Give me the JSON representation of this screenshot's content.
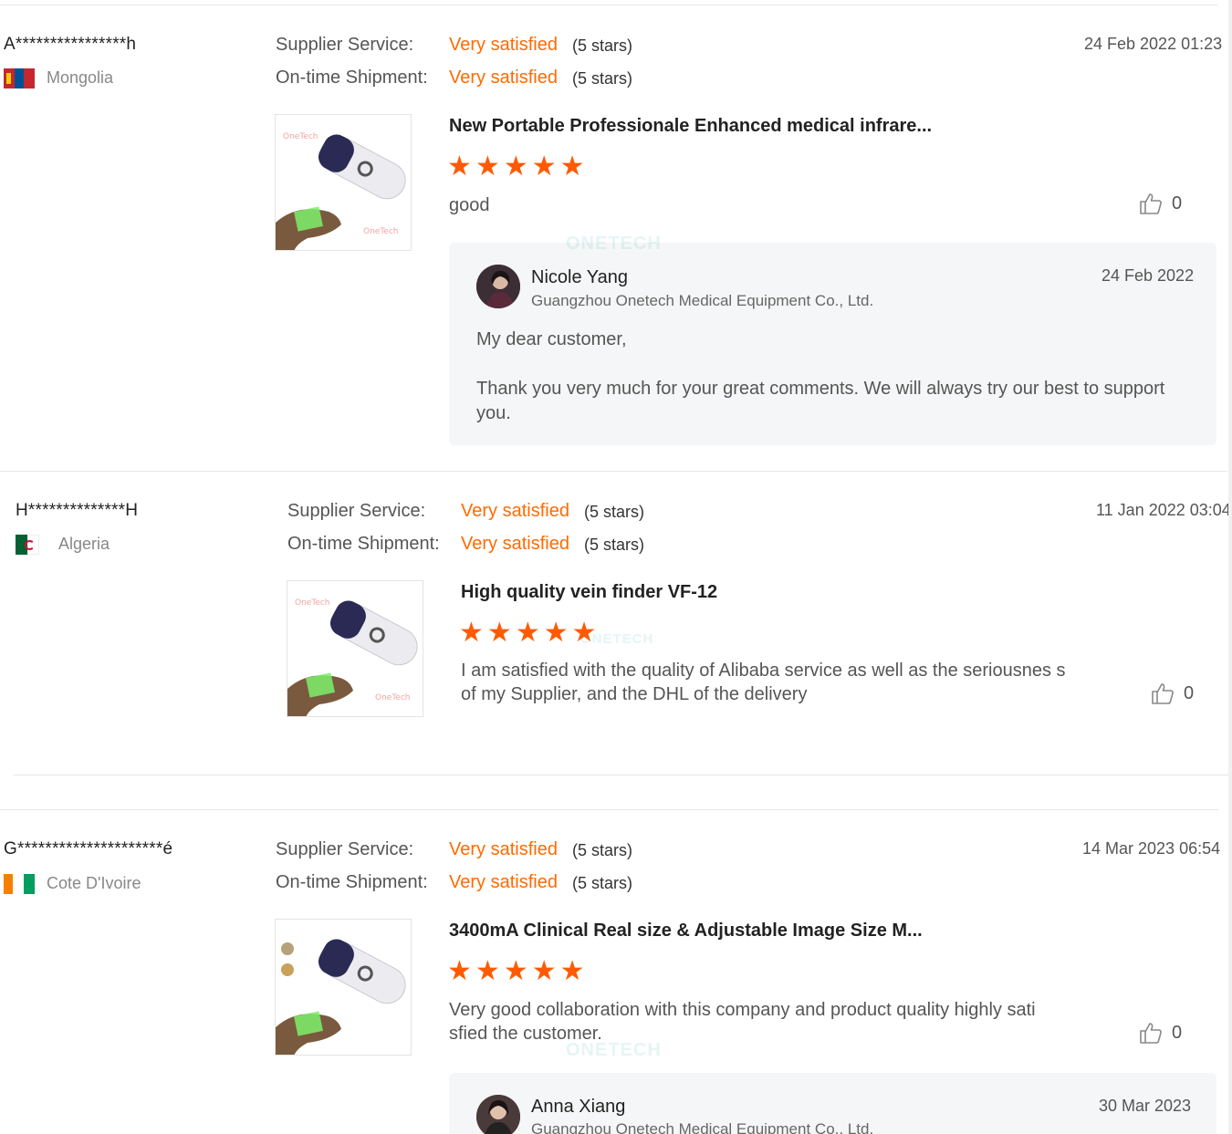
{
  "labels": {
    "supplier_service": "Supplier Service:",
    "ontime_shipment": "On-time Shipment:"
  },
  "colors": {
    "accent": "#ff6a00",
    "star": "#ff5a00",
    "reply_bg": "#f5f6f7"
  },
  "reviews": [
    {
      "buyer": "A****************h",
      "country": "Mongolia",
      "flag_colors": [
        "#c4272f",
        "#015197",
        "#c4272f"
      ],
      "date": "24 Feb 2022 01:23",
      "supplier_service": {
        "value": "Very satisfied",
        "stars": "(5 stars)"
      },
      "ontime_shipment": {
        "value": "Very satisfied",
        "stars": "(5 stars)"
      },
      "product_title": "New Portable Professionale Enhanced medical infrare...",
      "rating": 5,
      "comment": "good",
      "likes": "0",
      "reply": {
        "name": "Nicole Yang",
        "company": "Guangzhou Onetech Medical Equipment Co., Ltd.",
        "date": "24 Feb 2022",
        "greeting": "My dear customer,",
        "text": "Thank you very much for your great comments. We will always try our best to support you."
      }
    },
    {
      "buyer": "H**************H",
      "country": "Algeria",
      "flag_colors": [
        "#006233",
        "#ffffff",
        "#d21034"
      ],
      "date": "11 Jan 2022 03:04",
      "supplier_service": {
        "value": "Very satisfied",
        "stars": "(5 stars)"
      },
      "ontime_shipment": {
        "value": "Very satisfied",
        "stars": "(5 stars)"
      },
      "product_title": "High quality vein finder VF-12",
      "rating": 5,
      "comment": "I am satisfied with the quality of Alibaba service as well as the seriousnes s of my Supplier, and the DHL of the delivery",
      "likes": "0"
    },
    {
      "buyer": "G*********************é",
      "country": "Cote D'Ivoire",
      "flag_colors": [
        "#f77f00",
        "#ffffff",
        "#009e60"
      ],
      "date": "14 Mar 2023 06:54",
      "supplier_service": {
        "value": "Very satisfied",
        "stars": "(5 stars)"
      },
      "ontime_shipment": {
        "value": "Very satisfied",
        "stars": "(5 stars)"
      },
      "product_title": "3400mA Clinical Real size & Adjustable Image Size M...",
      "rating": 5,
      "comment": "Very good collaboration with this company and product quality highly sati sfied the customer.",
      "likes": "0",
      "reply": {
        "name": "Anna Xiang",
        "company": "Guangzhou Onetech Medical Equipment Co., Ltd.",
        "date": "30 Mar 2023"
      }
    }
  ],
  "watermark": "ONETECH"
}
